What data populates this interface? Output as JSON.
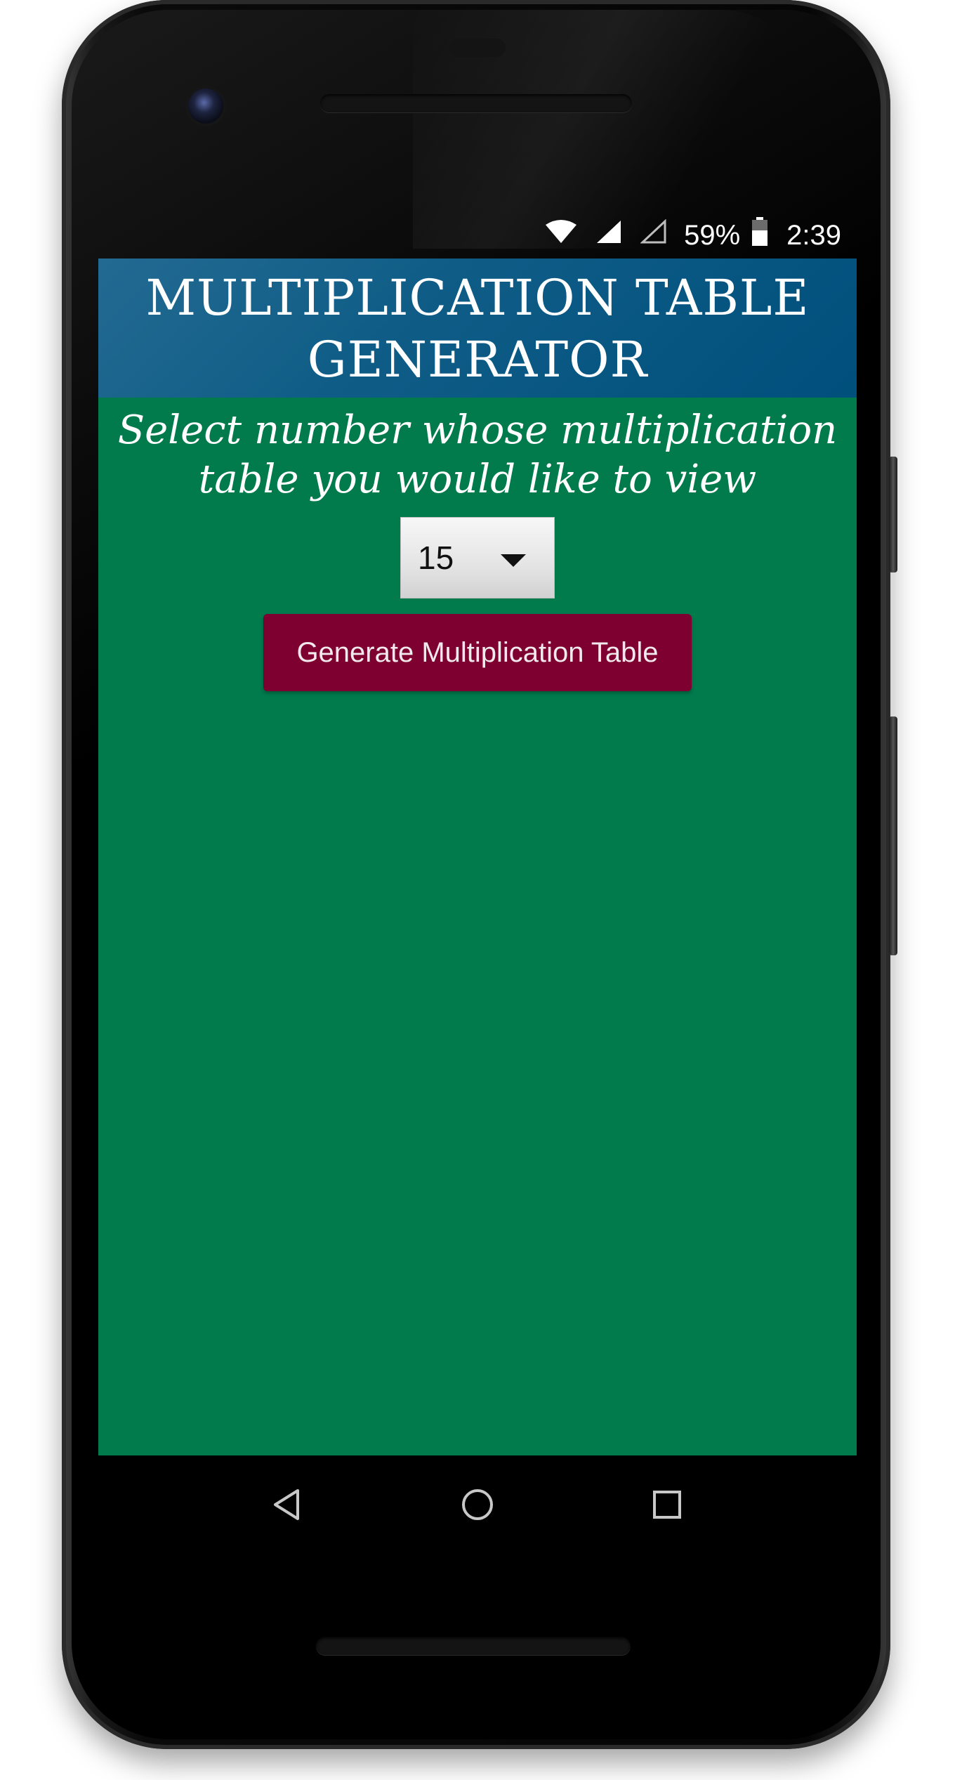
{
  "status_bar": {
    "battery_percent": "59%",
    "time": "2:39",
    "icons": [
      "wifi-icon",
      "cell-signal-icon",
      "cell-signal-empty-icon",
      "battery-icon"
    ]
  },
  "app": {
    "title": "MULTIPLICATION TABLE GENERATOR",
    "title_line1": "MULTIPLICATION TABLE",
    "title_line2": "GENERATOR",
    "prompt_line1": "Select number whose multiplication",
    "prompt_line2": "table you would like to view",
    "number_select": {
      "selected_value": "15"
    },
    "generate_button_label": "Generate Multiplication Table"
  },
  "nav_bar": {
    "icons": [
      "back-icon",
      "home-icon",
      "recents-icon"
    ]
  },
  "colors": {
    "header_blue": "#004f7c",
    "background_green": "#017a4c",
    "button_maroon": "#7e0030",
    "text_white": "#ffffff"
  }
}
